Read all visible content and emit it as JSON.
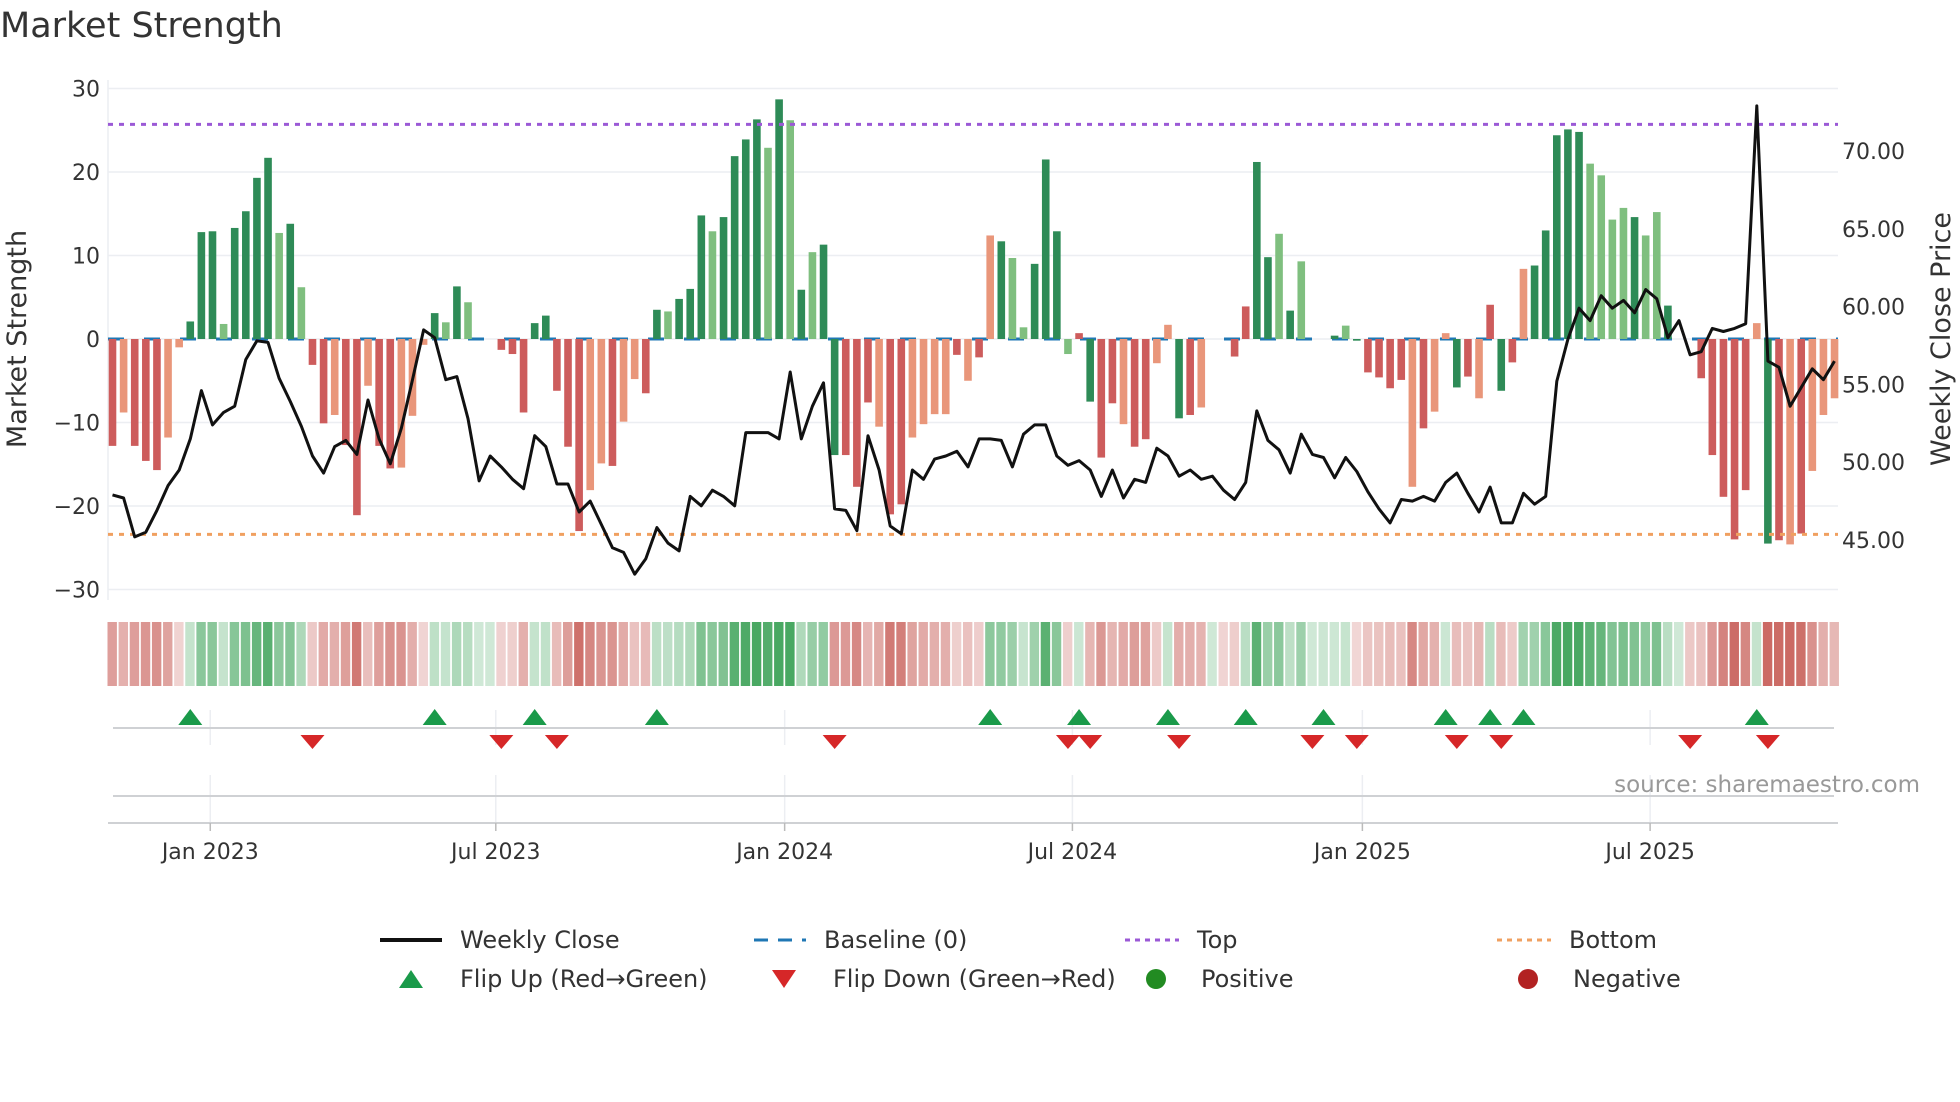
{
  "title": "Market Strength",
  "source": "source: sharemaestro.com",
  "colors": {
    "strong_green": "#2e8b57",
    "weak_green": "#7fbf7f",
    "strong_red": "#cd5c5c",
    "weak_red": "#e9967a",
    "baseline": "#1f77b4",
    "top": "#9b59d6",
    "bottom": "#f0a060",
    "close": "#111111",
    "flip_up": "#1a9a4a",
    "flip_down": "#d62728",
    "positive": "#228b22",
    "negative": "#b22222"
  },
  "chart_data": {
    "type": "bar",
    "title": "Market Strength",
    "ylabel": "Market Strength",
    "y2label": "Weekly Close Price",
    "ylim": [
      -30,
      30
    ],
    "y2lim": [
      42,
      73.5
    ],
    "yticks": [
      {
        "v": 30,
        "label": "30"
      },
      {
        "v": 20,
        "label": "20"
      },
      {
        "v": 10,
        "label": "10"
      },
      {
        "v": 0,
        "label": "0"
      },
      {
        "v": -10,
        "label": "−10"
      },
      {
        "v": -20,
        "label": "−20"
      },
      {
        "v": -30,
        "label": "−30"
      }
    ],
    "y2ticks": [
      {
        "v": 70,
        "label": "70.00"
      },
      {
        "v": 65,
        "label": "65.00"
      },
      {
        "v": 60,
        "label": "60.00"
      },
      {
        "v": 55,
        "label": "55.00"
      },
      {
        "v": 50,
        "label": "50.00"
      },
      {
        "v": 45,
        "label": "45.00"
      }
    ],
    "xticks": [
      {
        "week": 9.8,
        "label": "Jan 2023"
      },
      {
        "week": 35.5,
        "label": "Jul 2023"
      },
      {
        "week": 61.5,
        "label": "Jan 2024"
      },
      {
        "week": 87.4,
        "label": "Jul 2024"
      },
      {
        "week": 113.5,
        "label": "Jan 2025"
      },
      {
        "week": 139.4,
        "label": "Jul 2025"
      }
    ],
    "top_level": 25.7,
    "bottom_level": -23.4,
    "baseline": 0,
    "strength": [
      -12.8,
      -8.8,
      -12.8,
      -14.6,
      -15.7,
      -11.8,
      -1.0,
      2.1,
      12.8,
      12.9,
      1.8,
      13.3,
      15.3,
      19.3,
      21.7,
      12.7,
      13.8,
      6.2,
      -3.1,
      -10.1,
      -9.1,
      -12.7,
      -21.1,
      -5.6,
      -12.8,
      -15.5,
      -15.4,
      -9.2,
      -0.7,
      3.1,
      2.0,
      6.3,
      4.4,
      0,
      0,
      -1.3,
      -1.8,
      -8.8,
      1.9,
      2.8,
      -6.2,
      -12.9,
      -23.0,
      -18.1,
      -14.9,
      -15.2,
      -9.9,
      -4.8,
      -6.5,
      3.5,
      3.3,
      4.8,
      6.0,
      14.8,
      12.9,
      14.6,
      21.9,
      23.9,
      26.3,
      22.9,
      28.7,
      26.2,
      5.9,
      10.4,
      11.3,
      -13.9,
      -13.9,
      -17.7,
      -7.6,
      -10.5,
      -21.0,
      -19.8,
      -11.8,
      -10.2,
      -9.0,
      -9.0,
      -1.9,
      -5.0,
      -2.2,
      12.4,
      11.7,
      9.7,
      1.4,
      9.0,
      21.5,
      12.9,
      -1.8,
      0.7,
      -7.5,
      -14.2,
      -7.7,
      -10.2,
      -12.9,
      -12.0,
      -2.9,
      1.7,
      -9.5,
      -9.1,
      -8.2,
      0,
      -0.7,
      -2.1,
      3.9,
      21.2,
      9.8,
      12.6,
      3.4,
      9.3,
      0,
      0.6,
      0.4,
      1.6,
      -0.2,
      -4.0,
      -4.6,
      -5.9,
      -4.9,
      -17.7,
      -10.7,
      -8.7,
      0.7,
      -5.8,
      -4.5,
      -7.1,
      4.1,
      -6.2,
      -2.8,
      8.4,
      8.8,
      13.0,
      24.4,
      25.1,
      24.8,
      21.0,
      19.6,
      14.3,
      15.7,
      14.6,
      12.4,
      15.2,
      4.0,
      0,
      -3.4,
      -4.7,
      -13.9,
      -18.9,
      -24.0,
      -18.1,
      1.9,
      -24.5,
      -24.1,
      -24.6,
      -23.3,
      -15.8,
      -9.1,
      -7.1
    ],
    "shade": "RrRRRrrGGGgGGGGgGgRRrRRrRRrrrGgGg00RRRGGRRRrrRrrRGgGGGgGGGGgGgGgGGRRRrRRrrrrRrRrGggGGGgRGRRrRRrrGRrr0RRGGgGgG0GgGRRRRrRrrGRrRGRrGGGGGggggGggGg0RRRRRrGRrRrrrr",
    "weekly_close": [
      47.9,
      47.7,
      45.2,
      45.5,
      46.9,
      48.5,
      49.5,
      51.5,
      54.6,
      52.4,
      53.2,
      53.6,
      56.6,
      57.8,
      57.7,
      55.4,
      53.9,
      52.3,
      50.4,
      49.3,
      51.0,
      51.4,
      50.5,
      54.0,
      51.5,
      49.9,
      52.2,
      55.3,
      58.5,
      58.0,
      55.3,
      55.5,
      52.8,
      48.8,
      50.4,
      49.7,
      48.9,
      48.3,
      51.7,
      51.0,
      48.6,
      48.6,
      46.8,
      47.5,
      46.0,
      44.5,
      44.2,
      42.8,
      43.8,
      45.8,
      44.8,
      44.3,
      47.8,
      47.2,
      48.2,
      47.8,
      47.2,
      51.9,
      51.9,
      51.9,
      51.5,
      55.8,
      51.5,
      53.6,
      55.1,
      47.0,
      46.9,
      45.6,
      51.7,
      49.5,
      45.9,
      45.4,
      49.5,
      48.9,
      50.2,
      50.4,
      50.7,
      49.7,
      51.5,
      51.5,
      51.4,
      49.7,
      51.8,
      52.4,
      52.4,
      50.4,
      49.8,
      50.1,
      49.5,
      47.8,
      49.5,
      47.7,
      48.9,
      48.7,
      50.9,
      50.4,
      49.1,
      49.5,
      48.9,
      49.1,
      48.2,
      47.6,
      48.7,
      53.3,
      51.4,
      50.8,
      49.3,
      51.8,
      50.5,
      50.3,
      49.0,
      50.3,
      49.4,
      48.1,
      47.0,
      46.1,
      47.6,
      47.5,
      47.8,
      47.5,
      48.7,
      49.3,
      48.0,
      46.8,
      48.4,
      46.1,
      46.1,
      48.0,
      47.3,
      47.8,
      55.2,
      57.9,
      59.9,
      59.1,
      60.7,
      59.9,
      60.4,
      59.6,
      61.1,
      60.5,
      58.0,
      59.1,
      56.9,
      57.1,
      58.6,
      58.4,
      58.6,
      58.9,
      72.9,
      56.5,
      56.1,
      53.6,
      54.8,
      56.0,
      55.3,
      56.5
    ],
    "flip_up_weeks": [
      8,
      30,
      39,
      50,
      80,
      88,
      96,
      103,
      110,
      121,
      125,
      128,
      149
    ],
    "flip_down_weeks": [
      19,
      36,
      41,
      66,
      87,
      89,
      97,
      109,
      113,
      122,
      126,
      143,
      150
    ],
    "legend": {
      "weekly_close": "Weekly Close",
      "baseline": "Baseline (0)",
      "top": "Top",
      "bottom": "Bottom",
      "flip_up": "Flip Up (Red→Green)",
      "flip_down": "Flip Down (Green→Red)",
      "positive": "Positive",
      "negative": "Negative"
    }
  }
}
